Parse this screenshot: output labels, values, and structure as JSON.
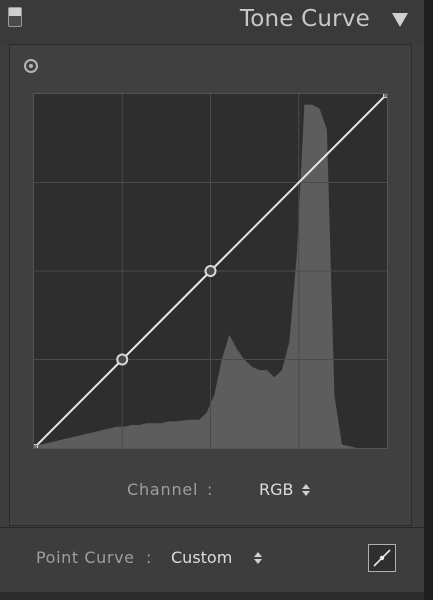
{
  "header": {
    "title": "Tone Curve",
    "toggle_icon": "panel-toggle-icon",
    "collapse_icon": "triangle-down-icon"
  },
  "target_adjust_icon": "target-icon",
  "curve": {
    "channel_label": "Channel",
    "channel_colon": ":",
    "channel_value": "RGB",
    "control_points": [
      {
        "input": 0,
        "output": 0
      },
      {
        "input": 0.25,
        "output": 0.25
      },
      {
        "input": 0.5,
        "output": 0.5
      },
      {
        "input": 1.0,
        "output": 1.0
      }
    ],
    "grid_divisions": 4,
    "curve_color": "#e8e8e8",
    "histogram_color": "#5d5d5d",
    "histogram": [
      0.005,
      0.01,
      0.015,
      0.02,
      0.025,
      0.03,
      0.035,
      0.04,
      0.045,
      0.05,
      0.055,
      0.06,
      0.06,
      0.065,
      0.065,
      0.07,
      0.07,
      0.07,
      0.075,
      0.075,
      0.078,
      0.08,
      0.08,
      0.1,
      0.15,
      0.25,
      0.32,
      0.28,
      0.25,
      0.23,
      0.22,
      0.22,
      0.2,
      0.22,
      0.3,
      0.55,
      0.97,
      0.97,
      0.96,
      0.9,
      0.15,
      0.01,
      0.005,
      0.0,
      0.0,
      0.0,
      0.0,
      0.0
    ]
  },
  "point_curve": {
    "label": "Point Curve",
    "colon": ":",
    "value": "Custom",
    "edit_icon": "point-curve-edit-icon"
  }
}
